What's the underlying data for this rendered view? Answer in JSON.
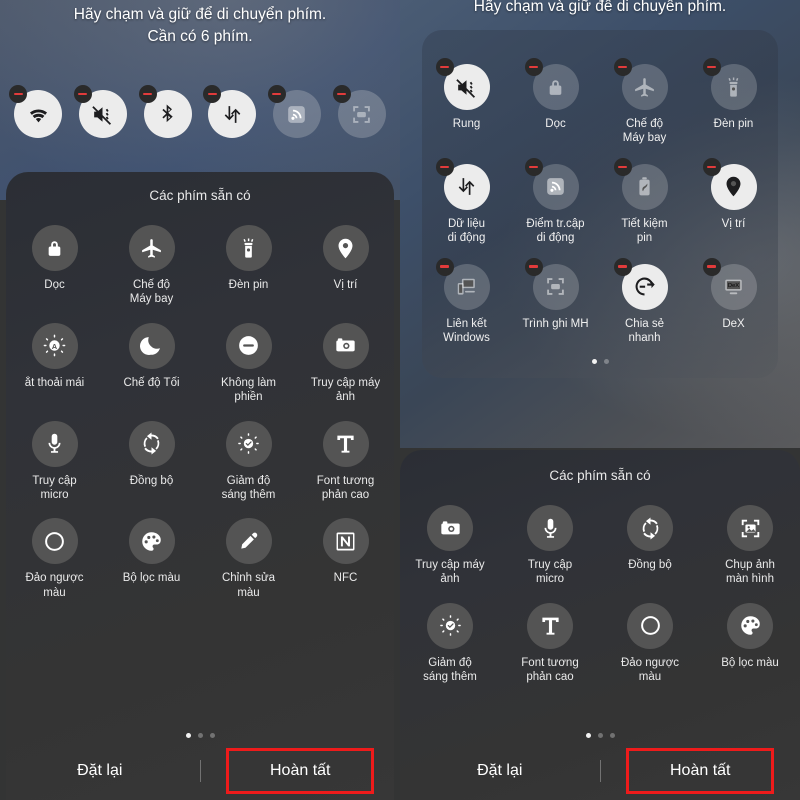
{
  "instruction": {
    "line1": "Hãy chạm và giữ để di chuyển phím.",
    "line2": "Cần có 6 phím."
  },
  "left_pane": {
    "active_chips": [
      {
        "label": "Wi-Fi",
        "icon": "wifi-icon",
        "enabled": true
      },
      {
        "label": "Rung",
        "icon": "vibrate-icon",
        "enabled": true
      },
      {
        "label": "Bluetooth",
        "icon": "bluetooth-icon",
        "enabled": true
      },
      {
        "label": "Dữ liệu di động",
        "icon": "mobile-data-icon",
        "enabled": true
      },
      {
        "label": "Điểm tr.cập di động",
        "icon": "hotspot-icon",
        "enabled": false
      },
      {
        "label": "Trình ghi MH",
        "icon": "screen-recorder-icon",
        "enabled": false
      }
    ],
    "sheet_title": "Các phím sẵn có",
    "tiles": [
      {
        "label": "Dọc",
        "icon": "rotation-lock-icon"
      },
      {
        "label": "Chế độ\nMáy bay",
        "icon": "airplane-icon"
      },
      {
        "label": "Đèn pin",
        "icon": "flashlight-icon"
      },
      {
        "label": "Vị trí",
        "icon": "location-pin-icon"
      },
      {
        "label": "ắt thoải mái",
        "icon": "eye-comfort-icon",
        "clipped": true
      },
      {
        "label": "Chế độ Tối",
        "icon": "dark-mode-icon"
      },
      {
        "label": "Không làm\nphiền",
        "icon": "do-not-disturb-icon"
      },
      {
        "label": "Truy cập máy\nảnh",
        "icon": "camera-access-icon"
      },
      {
        "label": "Truy cập\nmicro",
        "icon": "mic-access-icon"
      },
      {
        "label": "Đồng bộ",
        "icon": "sync-icon"
      },
      {
        "label": "Giảm độ\nsáng thêm",
        "icon": "extra-dim-icon"
      },
      {
        "label": "Font tương\nphản cao",
        "icon": "high-contrast-font-icon"
      },
      {
        "label": "Đảo ngược\nmàu",
        "icon": "color-inversion-icon"
      },
      {
        "label": "Bộ lọc màu",
        "icon": "color-filter-icon"
      },
      {
        "label": "Chỉnh sửa\nmàu",
        "icon": "color-correction-icon"
      },
      {
        "label": "NFC",
        "icon": "nfc-icon"
      }
    ],
    "page_dots": {
      "count": 3,
      "active_index": 0
    },
    "reset_label": "Đặt lại",
    "done_label": "Hoàn tất"
  },
  "right_pane": {
    "card_tiles": [
      {
        "label": "Rung",
        "icon": "vibrate-icon",
        "enabled": true
      },
      {
        "label": "Dọc",
        "icon": "rotation-lock-icon",
        "enabled": false
      },
      {
        "label": "Chế độ\nMáy bay",
        "icon": "airplane-icon",
        "enabled": false
      },
      {
        "label": "Đèn pin",
        "icon": "flashlight-icon",
        "enabled": false
      },
      {
        "label": "Dữ liệu\ndi động",
        "icon": "mobile-data-icon",
        "enabled": true
      },
      {
        "label": "Điểm tr.cập\ndi động",
        "icon": "hotspot-icon",
        "enabled": false
      },
      {
        "label": "Tiết kiệm\npin",
        "icon": "power-saving-icon",
        "enabled": false
      },
      {
        "label": "Vị trí",
        "icon": "location-pin-icon",
        "enabled": true
      },
      {
        "label": "Liên kết\nWindows",
        "icon": "link-to-windows-icon",
        "enabled": false
      },
      {
        "label": "Trình ghi MH",
        "icon": "screen-recorder-icon",
        "enabled": false
      },
      {
        "label": "Chia sẻ\nnhanh",
        "icon": "quick-share-icon",
        "enabled": true
      },
      {
        "label": "DeX",
        "icon": "dex-icon",
        "enabled": false
      }
    ],
    "card_dots": {
      "count": 2,
      "active_index": 0
    },
    "sheet_title": "Các phím sẵn có",
    "tiles": [
      {
        "label": "Truy cập máy\nảnh",
        "icon": "camera-access-icon"
      },
      {
        "label": "Truy cập\nmicro",
        "icon": "mic-access-icon"
      },
      {
        "label": "Đồng bộ",
        "icon": "sync-icon"
      },
      {
        "label": "Chụp ảnh\nmàn hình",
        "icon": "screenshot-icon"
      },
      {
        "label": "Giảm độ\nsáng thêm",
        "icon": "extra-dim-icon"
      },
      {
        "label": "Font tương\nphản cao",
        "icon": "high-contrast-font-icon"
      },
      {
        "label": "Đảo ngược\nmàu",
        "icon": "color-inversion-icon"
      },
      {
        "label": "Bộ lọc màu",
        "icon": "color-filter-icon"
      }
    ],
    "page_dots": {
      "count": 3,
      "active_index": 0
    },
    "reset_label": "Đặt lại",
    "done_label": "Hoàn tất"
  },
  "colors": {
    "highlight_border": "#ee1b1b",
    "badge_minus": "#e23b3b",
    "tile_circle": "#545454",
    "enabled_circle": "#ececec"
  }
}
